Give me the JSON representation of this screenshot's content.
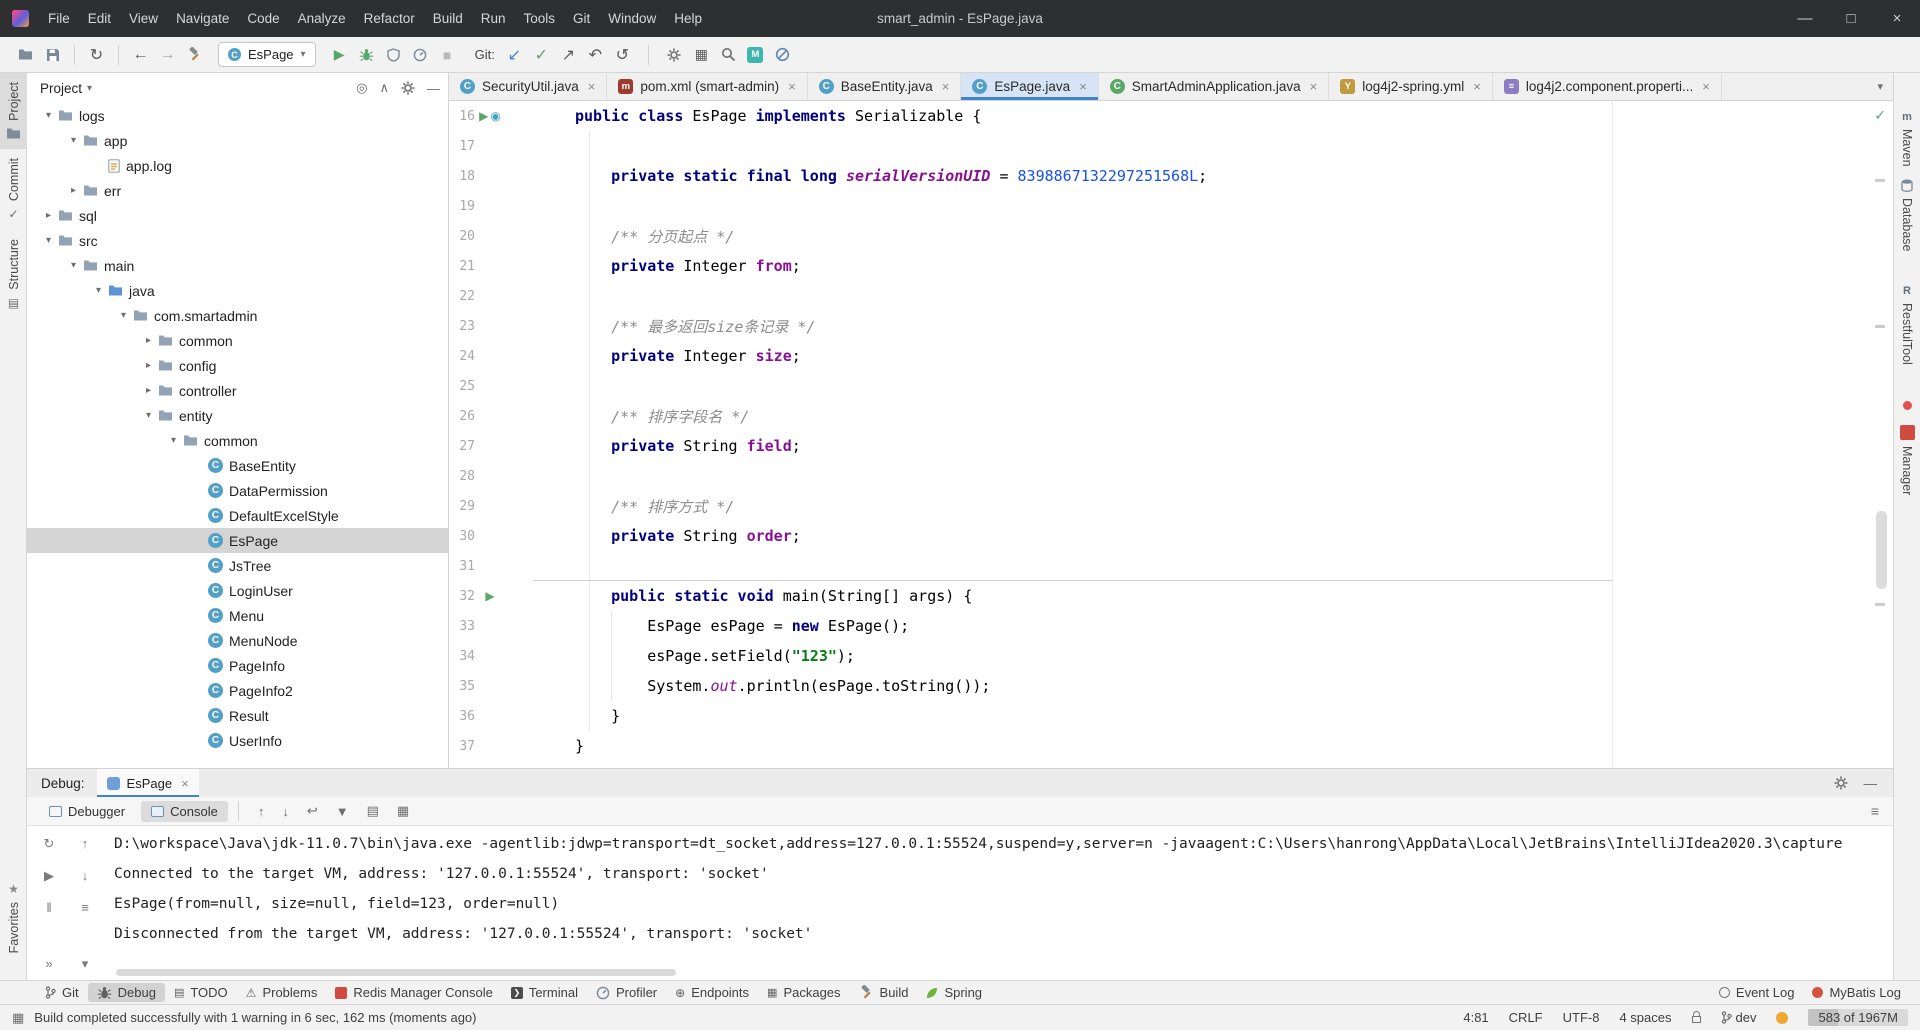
{
  "colors": {
    "accent_blue": "#4083c9",
    "selection_gray": "#d4d4d4",
    "run_green": "#59a869",
    "keyword": "#000080",
    "field_purple": "#871094",
    "string_green": "#067d17",
    "number_blue": "#1750eb",
    "comment_gray": "#8c8c8c",
    "redis_red": "#d04b3f"
  },
  "title_bar": {
    "menus": [
      "File",
      "Edit",
      "View",
      "Navigate",
      "Code",
      "Analyze",
      "Refactor",
      "Build",
      "Run",
      "Tools",
      "Git",
      "Window",
      "Help"
    ],
    "title": "smart_admin - EsPage.java",
    "window_controls": [
      "minimize",
      "maximize",
      "close"
    ]
  },
  "toolbar": {
    "left_icons": [
      "open",
      "save",
      "sync",
      "back",
      "forward",
      "hammer"
    ],
    "run_config": "EsPage",
    "run_icons": [
      "run",
      "debug",
      "coverage",
      "profiler",
      "stop"
    ],
    "git_label": "Git:",
    "git_icons": [
      "update",
      "commit",
      "push",
      "rollback",
      "history"
    ],
    "right_icons": [
      "settings",
      "structure",
      "search",
      "plugin-m",
      "plugin-block"
    ]
  },
  "left_stripe": {
    "top": [
      "Project",
      "Commit",
      "Structure"
    ],
    "bottom": [
      "Favorites"
    ]
  },
  "right_stripe": {
    "labels": [
      "Maven",
      "Database",
      "RestfulTool"
    ],
    "manager_label": "Manager"
  },
  "project": {
    "header": "Project",
    "tree": [
      {
        "label": "logs",
        "level": 0,
        "state": "open",
        "icon": "folder"
      },
      {
        "label": "app",
        "level": 1,
        "state": "open",
        "icon": "folder"
      },
      {
        "label": "app.log",
        "level": 2,
        "state": "leaf",
        "icon": "log"
      },
      {
        "label": "err",
        "level": 1,
        "state": "closed",
        "icon": "folder"
      },
      {
        "label": "sql",
        "level": 0,
        "state": "closed",
        "icon": "folder"
      },
      {
        "label": "src",
        "level": 0,
        "state": "open",
        "icon": "folder"
      },
      {
        "label": "main",
        "level": 1,
        "state": "open",
        "icon": "folder"
      },
      {
        "label": "java",
        "level": 2,
        "state": "open",
        "icon": "folder-src"
      },
      {
        "label": "com.smartadmin",
        "level": 3,
        "state": "open",
        "icon": "folder"
      },
      {
        "label": "common",
        "level": 4,
        "state": "closed",
        "icon": "folder"
      },
      {
        "label": "config",
        "level": 4,
        "state": "closed",
        "icon": "folder"
      },
      {
        "label": "controller",
        "level": 4,
        "state": "closed",
        "icon": "folder"
      },
      {
        "label": "entity",
        "level": 4,
        "state": "open",
        "icon": "folder"
      },
      {
        "label": "common",
        "level": 5,
        "state": "open",
        "icon": "folder"
      },
      {
        "label": "BaseEntity",
        "level": 6,
        "state": "leaf",
        "icon": "class"
      },
      {
        "label": "DataPermission",
        "level": 6,
        "state": "leaf",
        "icon": "class"
      },
      {
        "label": "DefaultExcelStyle",
        "level": 6,
        "state": "leaf",
        "icon": "class"
      },
      {
        "label": "EsPage",
        "level": 6,
        "state": "leaf",
        "icon": "class",
        "selected": true
      },
      {
        "label": "JsTree",
        "level": 6,
        "state": "leaf",
        "icon": "class"
      },
      {
        "label": "LoginUser",
        "level": 6,
        "state": "leaf",
        "icon": "class"
      },
      {
        "label": "Menu",
        "level": 6,
        "state": "leaf",
        "icon": "class"
      },
      {
        "label": "MenuNode",
        "level": 6,
        "state": "leaf",
        "icon": "class"
      },
      {
        "label": "PageInfo",
        "level": 6,
        "state": "leaf",
        "icon": "class"
      },
      {
        "label": "PageInfo2",
        "level": 6,
        "state": "leaf",
        "icon": "class"
      },
      {
        "label": "Result",
        "level": 6,
        "state": "leaf",
        "icon": "class"
      },
      {
        "label": "UserInfo",
        "level": 6,
        "state": "leaf",
        "icon": "class"
      }
    ]
  },
  "editor": {
    "tabs": [
      {
        "label": "SecurityUtil.java",
        "icon": "class"
      },
      {
        "label": "pom.xml (smart-admin)",
        "icon": "maven"
      },
      {
        "label": "BaseEntity.java",
        "icon": "class"
      },
      {
        "label": "EsPage.java",
        "icon": "class",
        "active": true
      },
      {
        "label": "SmartAdminApplication.java",
        "icon": "class-green"
      },
      {
        "label": "log4j2-spring.yml",
        "icon": "yaml"
      },
      {
        "label": "log4j2.component.properti...",
        "icon": "properties"
      }
    ],
    "lines": [
      {
        "n": 16,
        "gutter": [
          "run",
          "rerun"
        ],
        "tokens": [
          [
            "k",
            "public class "
          ],
          [
            "p",
            "EsPage "
          ],
          [
            "k",
            "implements "
          ],
          [
            "p",
            "Serializable {"
          ]
        ]
      },
      {
        "n": 17,
        "tokens": []
      },
      {
        "n": 18,
        "tokens": [
          [
            "k",
            "    private static final long "
          ],
          [
            "sfb",
            "serialVersionUID"
          ],
          [
            "p",
            " = "
          ],
          [
            "num",
            "8398867132297251568L"
          ],
          [
            "p",
            ";"
          ]
        ]
      },
      {
        "n": 19,
        "tokens": []
      },
      {
        "n": 20,
        "tokens": [
          [
            "c",
            "    /** 分页起点 */"
          ]
        ]
      },
      {
        "n": 21,
        "tokens": [
          [
            "k",
            "    private "
          ],
          [
            "p",
            "Integer "
          ],
          [
            "f",
            "from"
          ],
          [
            "p",
            ";"
          ]
        ]
      },
      {
        "n": 22,
        "tokens": []
      },
      {
        "n": 23,
        "tokens": [
          [
            "c",
            "    /** 最多返回size条记录 */"
          ]
        ]
      },
      {
        "n": 24,
        "tokens": [
          [
            "k",
            "    private "
          ],
          [
            "p",
            "Integer "
          ],
          [
            "f",
            "size"
          ],
          [
            "p",
            ";"
          ]
        ]
      },
      {
        "n": 25,
        "tokens": []
      },
      {
        "n": 26,
        "tokens": [
          [
            "c",
            "    /** 排序字段名 */"
          ]
        ]
      },
      {
        "n": 27,
        "tokens": [
          [
            "k",
            "    private "
          ],
          [
            "p",
            "String "
          ],
          [
            "f",
            "field"
          ],
          [
            "p",
            ";"
          ]
        ]
      },
      {
        "n": 28,
        "tokens": []
      },
      {
        "n": 29,
        "tokens": [
          [
            "c",
            "    /** 排序方式 */"
          ]
        ]
      },
      {
        "n": 30,
        "tokens": [
          [
            "k",
            "    private "
          ],
          [
            "p",
            "String "
          ],
          [
            "f",
            "order"
          ],
          [
            "p",
            ";"
          ]
        ]
      },
      {
        "n": 31,
        "tokens": [],
        "sep": true
      },
      {
        "n": 32,
        "gutter": [
          "run"
        ],
        "tokens": [
          [
            "k",
            "    public static void "
          ],
          [
            "p",
            "main(String[] args) {"
          ]
        ]
      },
      {
        "n": 33,
        "tokens": [
          [
            "p",
            "        EsPage esPage = "
          ],
          [
            "k",
            "new "
          ],
          [
            "p",
            "EsPage();"
          ]
        ]
      },
      {
        "n": 34,
        "tokens": [
          [
            "p",
            "        esPage.setField("
          ],
          [
            "s",
            "\"123\""
          ],
          [
            "p",
            ");"
          ]
        ]
      },
      {
        "n": 35,
        "tokens": [
          [
            "p",
            "        System."
          ],
          [
            "si",
            "out"
          ],
          [
            "p",
            ".println(esPage.toString());"
          ]
        ]
      },
      {
        "n": 36,
        "tokens": [
          [
            "p",
            "    }"
          ]
        ]
      },
      {
        "n": 37,
        "tokens": [
          [
            "p",
            "}"
          ]
        ]
      }
    ]
  },
  "debug": {
    "label": "Debug:",
    "session_tab": "EsPage",
    "tabs": [
      {
        "label": "Debugger",
        "active": false
      },
      {
        "label": "Console",
        "active": true
      }
    ],
    "console": [
      "D:\\workspace\\Java\\jdk-11.0.7\\bin\\java.exe -agentlib:jdwp=transport=dt_socket,address=127.0.0.1:55524,suspend=y,server=n -javaagent:C:\\Users\\hanrong\\AppData\\Local\\JetBrains\\IntelliJIdea2020.3\\capture",
      "Connected to the target VM, address: '127.0.0.1:55524', transport: 'socket'",
      "EsPage(from=null, size=null, field=123, order=null)",
      "Disconnected from the target VM, address: '127.0.0.1:55524', transport: 'socket'"
    ]
  },
  "tool_window_bar": {
    "left": [
      {
        "label": "Git",
        "icon": "git"
      },
      {
        "label": "Debug",
        "icon": "debug",
        "active": true
      },
      {
        "label": "TODO",
        "icon": "todo"
      },
      {
        "label": "Problems",
        "icon": "problems"
      },
      {
        "label": "Redis Manager Console",
        "icon": "redis"
      },
      {
        "label": "Terminal",
        "icon": "terminal"
      },
      {
        "label": "Profiler",
        "icon": "profiler"
      },
      {
        "label": "Endpoints",
        "icon": "endpoints"
      },
      {
        "label": "Packages",
        "icon": "packages"
      },
      {
        "label": "Build",
        "icon": "build"
      },
      {
        "label": "Spring",
        "icon": "spring"
      }
    ],
    "right": [
      {
        "label": "Event Log",
        "icon": "eventlog"
      },
      {
        "label": "MyBatis Log",
        "icon": "mybatis"
      }
    ]
  },
  "status_bar": {
    "message": "Build completed successfully with 1 warning in 6 sec, 162 ms (moments ago)",
    "caret": "4:81",
    "line_ending": "CRLF",
    "encoding": "UTF-8",
    "indent": "4 spaces",
    "branch": "dev",
    "memory": "583 of 1967M"
  }
}
